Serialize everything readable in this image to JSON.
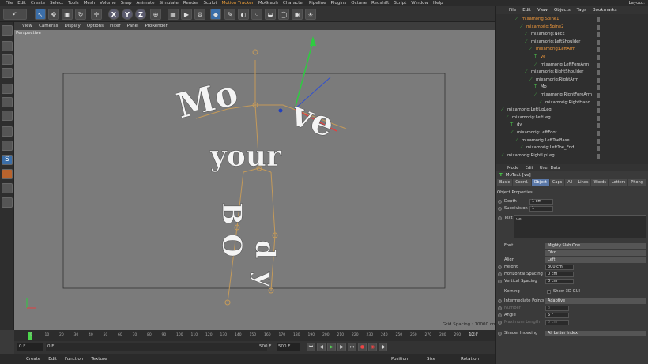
{
  "menubar": {
    "items": [
      "File",
      "Edit",
      "Create",
      "Select",
      "Tools",
      "Mesh",
      "Volume",
      "Snap",
      "Animate",
      "Simulate",
      "Render",
      "Sculpt",
      "Motion Tracker",
      "MoGraph",
      "Character",
      "Pipeline",
      "Plugins",
      "Octane",
      "Redshift",
      "Script",
      "Window",
      "Help"
    ],
    "layout": "Layout:"
  },
  "viewport": {
    "menu": [
      "View",
      "Cameras",
      "Display",
      "Options",
      "Filter",
      "Panel",
      "ProRender"
    ],
    "label": "Perspective",
    "grid_spacing": "Grid Spacing : 10000 cm"
  },
  "text3d": {
    "line1a": "Mo",
    "line1b": "ve",
    "line2": "your",
    "line3": "B",
    "line4": "O",
    "line5": "d",
    "line6": "y"
  },
  "timeline": {
    "ticks": [
      "0",
      "10",
      "20",
      "30",
      "40",
      "50",
      "60",
      "70",
      "80",
      "90",
      "100",
      "110",
      "120",
      "130",
      "140",
      "150",
      "160",
      "170",
      "180",
      "190",
      "200",
      "210",
      "220",
      "230",
      "240",
      "250",
      "260",
      "270",
      "280",
      "290",
      "300"
    ],
    "frame_end_right": "12 F"
  },
  "transport": {
    "start": "0 F",
    "mid": "0 F",
    "end1": "500 F",
    "end2": "500 F"
  },
  "bottom": {
    "tabs": [
      "Create",
      "Edit",
      "Function",
      "Texture"
    ],
    "coords": [
      "Position",
      "Size",
      "Rotation"
    ]
  },
  "objmgr": {
    "menu": [
      "File",
      "Edit",
      "View",
      "Objects",
      "Tags",
      "Bookmarks"
    ],
    "rows": [
      {
        "label": "mixamorig:Spine1",
        "indent": 30,
        "sel": true
      },
      {
        "label": "mixamorig:Spine2",
        "indent": 36,
        "sel": true
      },
      {
        "label": "mixamorig:Neck",
        "indent": 42,
        "sel": false
      },
      {
        "label": "mixamorig:LeftShoulder",
        "indent": 42,
        "sel": false
      },
      {
        "label": "mixamorig:LeftArm",
        "indent": 48,
        "sel": true
      },
      {
        "label": "ve",
        "indent": 54,
        "sel": true
      },
      {
        "label": "mixamorig:LeftForeArm",
        "indent": 54,
        "sel": false
      },
      {
        "label": "mixamorig:RightShoulder",
        "indent": 42,
        "sel": false
      },
      {
        "label": "mixamorig:RightArm",
        "indent": 48,
        "sel": false
      },
      {
        "label": "Mo",
        "indent": 54,
        "sel": false
      },
      {
        "label": "mixamorig:RightForeArm",
        "indent": 54,
        "sel": false
      },
      {
        "label": "mixamorig:RightHand",
        "indent": 60,
        "sel": false
      },
      {
        "label": "mixamorig:LeftUpLeg",
        "indent": 12,
        "sel": false
      },
      {
        "label": "mixamorig:LeftLeg",
        "indent": 18,
        "sel": false
      },
      {
        "label": "dy",
        "indent": 24,
        "sel": false
      },
      {
        "label": "mixamorig:LeftFoot",
        "indent": 24,
        "sel": false
      },
      {
        "label": "mixamorig:LeftToeBase",
        "indent": 30,
        "sel": false
      },
      {
        "label": "mixamorig:LeftToe_End",
        "indent": 36,
        "sel": false
      },
      {
        "label": "mixamorig:RightUpLeg",
        "indent": 12,
        "sel": false
      }
    ]
  },
  "attr": {
    "menu": [
      "Mode",
      "Edit",
      "User Data"
    ],
    "title": "MoText [ve]",
    "tabs": [
      "Basic",
      "Coord.",
      "Object",
      "Caps",
      "All",
      "Lines",
      "Words",
      "Letters",
      "Phong"
    ],
    "active_tab": "Object",
    "section": "Object Properties",
    "depth_label": "Depth",
    "depth": "1 cm",
    "subdiv_label": "Subdivision",
    "subdiv": "1",
    "text_label": "Text",
    "text": "ve",
    "font_label": "Font",
    "font1": "Mighty Slab One",
    "font2": "Ohz",
    "align_label": "Align",
    "align": "Left",
    "height_label": "Height",
    "height": "300 cm",
    "hspacing_label": "Horizontal Spacing",
    "hspacing": "0 cm",
    "vspacing_label": "Vertical Spacing",
    "vspacing": "0 cm",
    "kerning_label": "Kerning",
    "show3d": "Show 3D GUI",
    "ip_label": "Intermediate Points",
    "ip": "Adaptive",
    "number_label": "Number",
    "number": "8",
    "angle_label": "Angle",
    "angle": "5 °",
    "maxlen_label": "Maximum Length",
    "maxlen": "5 cm",
    "shader_label": "Shader Indexing",
    "shader": "All Letter Index"
  }
}
